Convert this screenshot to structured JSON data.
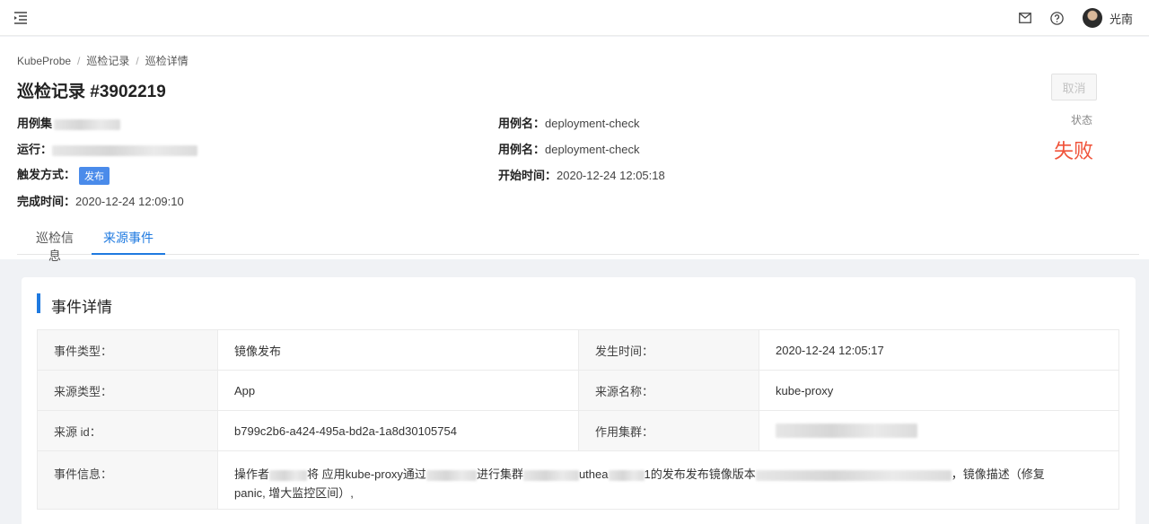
{
  "header": {
    "user_name": "光南"
  },
  "breadcrumb": [
    "KubeProbe",
    "巡检记录",
    "巡检详情"
  ],
  "page_title": "巡检记录 #3902219",
  "cancel_label": "取消",
  "info": {
    "case_set_label": "用例集",
    "case_name_label_1": "用例名：",
    "case_name_value_1": "deployment-check",
    "run_label": "运行：",
    "run_value_visible": "_ap-southeast-1_pai_...",
    "case_name_label_2": "用例名：",
    "case_name_value_2": "deployment-check",
    "trigger_label": "触发方式：",
    "trigger_tag": "发布",
    "start_label": "开始时间：",
    "start_value": "2020-12-24 12:05:18",
    "finish_label": "完成时间：",
    "finish_value": "2020-12-24 12:09:10",
    "status_label": "状态",
    "status_value": "失败"
  },
  "tabs": [
    "巡检信息",
    "来源事件"
  ],
  "active_tab": "来源事件",
  "event": {
    "title": "事件详情",
    "rows": [
      {
        "l1": "事件类型：",
        "v1": "镜像发布",
        "l2": "发生时间：",
        "v2": "2020-12-24 12:05:17"
      },
      {
        "l1": "来源类型：",
        "v1": "App",
        "l2": "来源名称：",
        "v2": "kube-proxy"
      },
      {
        "l1": "来源 id：",
        "v1": "b799c2b6-a424-495a-bd2a-1a8d30105754",
        "l2": "作用集群：",
        "v2": ""
      }
    ],
    "info_label": "事件信息：",
    "info_parts": [
      "操作者",
      "将 应用kube-proxy通过",
      "进行集群",
      "uthea",
      "1的发布发布镜像版本",
      "，镜像描述（修复",
      "panic, 增大监控区间）,"
    ]
  },
  "colors": {
    "accent": "#1f7ae0",
    "fail": "#f0533a",
    "tag": "#4a8bea"
  },
  "icons": [
    "menu-fold-icon",
    "mail-icon",
    "help-icon",
    "avatar"
  ]
}
